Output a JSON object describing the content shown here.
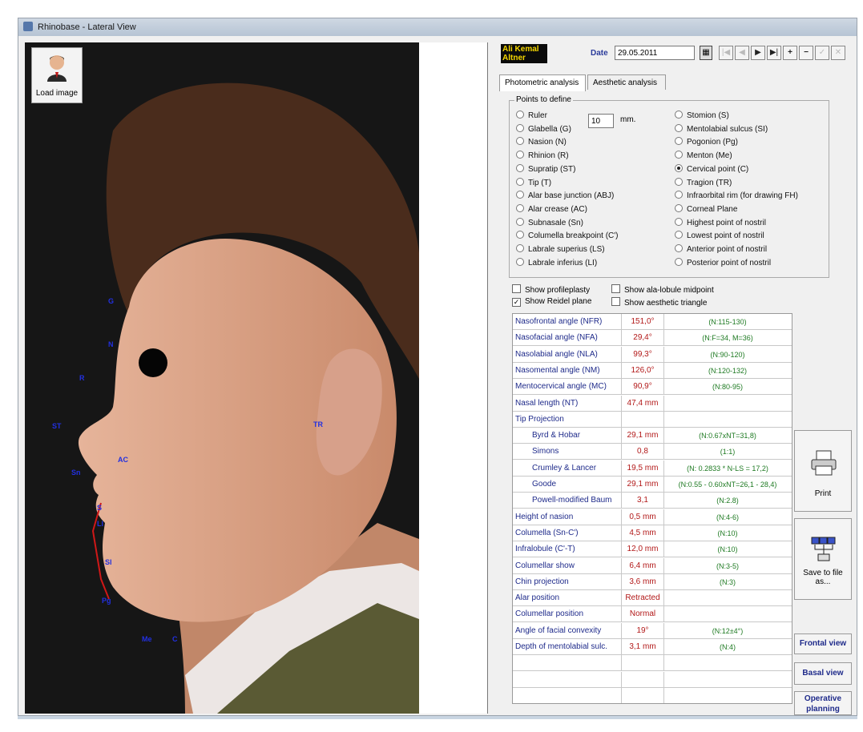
{
  "window": {
    "title": "Rhinobase - Lateral View",
    "load_image_label": "Load image"
  },
  "landmarks": [
    "G",
    "N",
    "R",
    "ST",
    "TR",
    "AC",
    "Sn",
    "S",
    "LI",
    "Sl",
    "Pg",
    "Me",
    "C"
  ],
  "patient": {
    "name": "Ali Kemal Altner"
  },
  "date": {
    "label": "Date",
    "value": "29.05.2011"
  },
  "nav_buttons": [
    "|◀",
    "◀",
    "▶",
    "▶|",
    "+",
    "−",
    "✓",
    "✕"
  ],
  "tabs": [
    "Photometric analysis",
    "Aesthetic analysis"
  ],
  "points": {
    "legend": "Points to define",
    "ruler_value": "10",
    "ruler_unit": "mm.",
    "left": [
      "Ruler",
      "Glabella (G)",
      "Nasion (N)",
      "Rhinion (R)",
      "Supratip (ST)",
      "Tip (T)",
      "Alar base junction (ABJ)",
      "Alar crease (AC)",
      "Subnasale (Sn)",
      "Columella breakpoint (C')",
      "Labrale superius (LS)",
      "Labrale inferius (LI)"
    ],
    "right": [
      "Stomion (S)",
      "Mentolabial sulcus (SI)",
      "Pogonion (Pg)",
      "Menton (Me)",
      "Cervical point (C)",
      "Tragion (TR)",
      "Infraorbital rim (for drawing FH)",
      "Corneal Plane",
      "Highest point of nostril",
      "Lowest point of nostril",
      "Anterior point of nostril",
      "Posterior point of nostril"
    ],
    "selected": "Cervical point (C)"
  },
  "checkboxes": [
    {
      "label": "Show profileplasty",
      "checked": false
    },
    {
      "label": "Show ala-lobule midpoint",
      "checked": false
    },
    {
      "label": "Show Reidel plane",
      "checked": true
    },
    {
      "label": "Show aesthetic triangle",
      "checked": false
    }
  ],
  "measurements": [
    {
      "name": "Nasofrontal angle (NFR)",
      "value": "151,0°",
      "norm": "(N:115-130)"
    },
    {
      "name": "Nasofacial angle (NFA)",
      "value": "29,4°",
      "norm": "(N:F=34, M=36)"
    },
    {
      "name": "Nasolabial angle (NLA)",
      "value": "99,3°",
      "norm": "(N:90-120)"
    },
    {
      "name": "Nasomental angle (NM)",
      "value": "126,0°",
      "norm": "(N:120-132)"
    },
    {
      "name": "Mentocervical angle (MC)",
      "value": "90,9°",
      "norm": "(N:80-95)"
    },
    {
      "name": "Nasal length (NT)",
      "value": "47,4 mm",
      "norm": ""
    },
    {
      "name": "Tip Projection",
      "value": "",
      "norm": ""
    },
    {
      "name": "Byrd & Hobar",
      "value": "29,1 mm",
      "norm": "(N:0.67xNT=31,8)",
      "sub": true
    },
    {
      "name": "Simons",
      "value": "0,8",
      "norm": "(1:1)",
      "sub": true
    },
    {
      "name": "Crumley & Lancer",
      "value": "19,5 mm",
      "norm": "(N: 0.2833 * N-LS = 17,2)",
      "sub": true
    },
    {
      "name": "Goode",
      "value": "29,1 mm",
      "norm": "(N:0.55 - 0.60xNT=26,1 - 28,4)",
      "sub": true
    },
    {
      "name": "Powell-modified Baum",
      "value": "3,1",
      "norm": "(N:2.8)",
      "sub": true
    },
    {
      "name": "Height of nasion",
      "value": "0,5 mm",
      "norm": "(N:4-6)"
    },
    {
      "name": "Columella (Sn-C')",
      "value": "4,5 mm",
      "norm": "(N:10)"
    },
    {
      "name": "Infralobule (C'-T)",
      "value": "12,0 mm",
      "norm": "(N:10)"
    },
    {
      "name": "Columellar show",
      "value": "6,4 mm",
      "norm": "(N:3-5)"
    },
    {
      "name": "Chin projection",
      "value": "3,6 mm",
      "norm": "(N:3)"
    },
    {
      "name": "Alar position",
      "value": "Retracted",
      "norm": ""
    },
    {
      "name": "Columellar position",
      "value": "Normal",
      "norm": ""
    },
    {
      "name": "Angle of facial convexity",
      "value": "19°",
      "norm": "(N:12±4°)"
    },
    {
      "name": "Depth of mentolabial sulc.",
      "value": "3,1 mm",
      "norm": "(N:4)"
    }
  ],
  "actions": {
    "print": "Print",
    "save": "Save to file as...",
    "frontal": "Frontal view",
    "basal": "Basal view",
    "operative": "Operative planning"
  }
}
